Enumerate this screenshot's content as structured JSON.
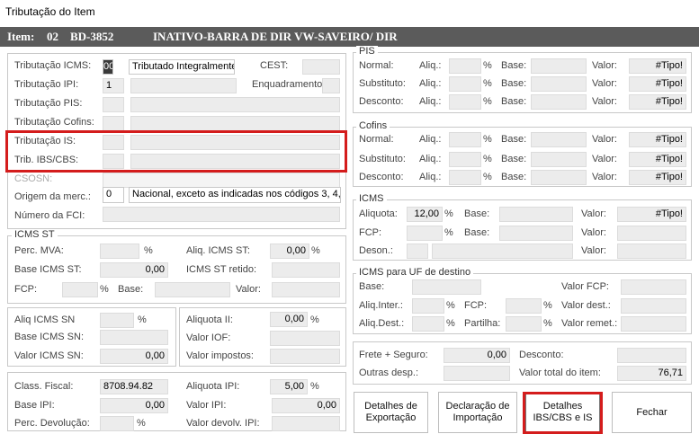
{
  "window": {
    "title": "Tributação do Item"
  },
  "header": {
    "item_label": "Item:",
    "item_number": "02",
    "code": "BD-3852",
    "description": "INATIVO-BARRA DE DIR VW-SAVEIRO/ DIR"
  },
  "trib": {
    "icms_label": "Tributação ICMS:",
    "icms_code": "00",
    "icms_desc": "Tributado Integralmente",
    "cest_label": "CEST:",
    "cest_value": "",
    "ipi_label": "Tributação IPI:",
    "ipi_code": "1",
    "ipi_desc": "",
    "enq_label": "Enquadramento:",
    "enq_value": "",
    "pis_label": "Tributação PIS:",
    "cofins_label": "Tributação Cofins:",
    "is_label": "Tributação IS:",
    "ibscbs_label": "Trib. IBS/CBS:",
    "csosn_label": "CSOSN:",
    "origem_label": "Origem da merc.:",
    "origem_code": "0",
    "origem_desc": "Nacional, exceto as indicadas nos códigos 3, 4, 5 e 8.",
    "fci_label": "Número da FCI:",
    "fci_value": ""
  },
  "pis": {
    "legend": "PIS",
    "rows": [
      {
        "label": "Normal:",
        "aliq": "Aliq.:",
        "base": "Base:",
        "valor": "Valor:",
        "value": "#Tipo!"
      },
      {
        "label": "Substituto:",
        "aliq": "Aliq.:",
        "base": "Base:",
        "valor": "Valor:",
        "value": "#Tipo!"
      },
      {
        "label": "Desconto:",
        "aliq": "Aliq.:",
        "base": "Base:",
        "valor": "Valor:",
        "value": "#Tipo!"
      }
    ]
  },
  "cofins": {
    "legend": "Cofins",
    "rows": [
      {
        "label": "Normal:",
        "aliq": "Aliq.:",
        "base": "Base:",
        "valor": "Valor:",
        "value": "#Tipo!"
      },
      {
        "label": "Substituto:",
        "aliq": "Aliq.:",
        "base": "Base:",
        "valor": "Valor:",
        "value": "#Tipo!"
      },
      {
        "label": "Desconto:",
        "aliq": "Aliq.:",
        "base": "Base:",
        "valor": "Valor:",
        "value": "#Tipo!"
      }
    ]
  },
  "icms": {
    "legend": "ICMS",
    "aliquota_label": "Aliquota:",
    "aliquota": "12,00",
    "base_label": "Base:",
    "valor_label": "Valor:",
    "valor": "#Tipo!",
    "fcp_label": "FCP:",
    "deson_label": "Deson.:"
  },
  "uf": {
    "legend": "ICMS para UF de destino",
    "base_label": "Base:",
    "valor_fcp_label": "Valor FCP:",
    "aliq_inter_label": "Aliq.Inter.:",
    "fcp_label": "FCP:",
    "valor_dest_label": "Valor dest.:",
    "aliq_dest_label": "Aliq.Dest.:",
    "partilha_label": "Partilha:",
    "valor_remet_label": "Valor remet.:"
  },
  "icms_st": {
    "legend": "ICMS ST",
    "mva_label": "Perc. MVA:",
    "aliq_st_label": "Aliq. ICMS ST:",
    "aliq_st": "0,00",
    "base_st_label": "Base ICMS ST:",
    "base_st": "0,00",
    "retido_label": "ICMS ST retido:",
    "fcp_label": "FCP:",
    "base_label": "Base:",
    "valor_label": "Valor:"
  },
  "sn": {
    "aliq_label": "Aliq ICMS SN",
    "base_label": "Base ICMS SN:",
    "valor_label": "Valor ICMS SN:",
    "valor": "0,00"
  },
  "ii": {
    "aliquota_label": "Aliquota II:",
    "aliquota": "0,00",
    "iof_label": "Valor IOF:",
    "impostos_label": "Valor impostos:"
  },
  "totals": {
    "frete_label": "Frete + Seguro:",
    "frete": "0,00",
    "desconto_label": "Desconto:",
    "outras_label": "Outras desp.:",
    "total_label": "Valor total do item:",
    "total": "76,71"
  },
  "fiscal": {
    "class_label": "Class. Fiscal:",
    "class_value": "8708.94.82",
    "aliq_ipi_label": "Aliquota IPI:",
    "aliq_ipi": "5,00",
    "base_ipi_label": "Base IPI:",
    "base_ipi": "0,00",
    "valor_ipi_label": "Valor IPI:",
    "valor_ipi": "0,00",
    "perc_dev_label": "Perc. Devolução:",
    "valor_devolv_label": "Valor devolv. IPI:"
  },
  "buttons": {
    "exportacao": "Detalhes de Exportação",
    "importacao": "Declaração de Importação",
    "ibscbs": "Detalhes IBS/CBS e IS",
    "fechar": "Fechar"
  },
  "units": {
    "pct": "%"
  }
}
